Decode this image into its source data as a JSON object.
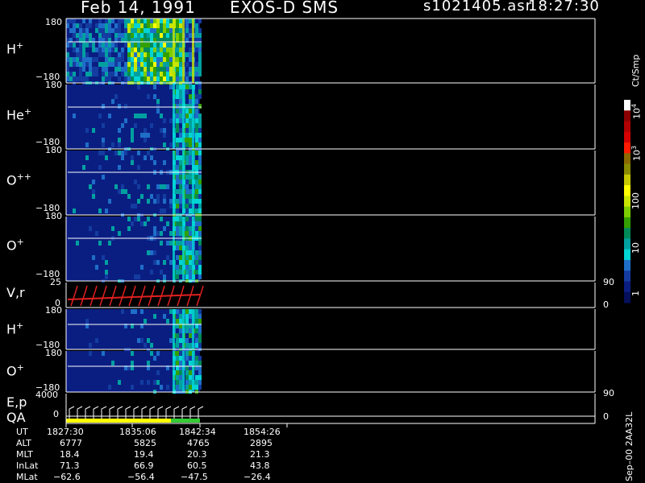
{
  "header": {
    "date": "Feb 14, 1991",
    "mission": "EXOS-D SMS",
    "file": "s1021405.asr",
    "time": "18:27:30"
  },
  "panels": [
    {
      "id": "h_plus",
      "label": "H",
      "sup": "+",
      "ymax": "180",
      "ymin": "−180"
    },
    {
      "id": "he_plus",
      "label": "He",
      "sup": "+",
      "ymax": "180",
      "ymin": "−180"
    },
    {
      "id": "o_pp",
      "label": "O",
      "sup": "++",
      "ymax": "180",
      "ymin": "−180"
    },
    {
      "id": "o_plus",
      "label": "O",
      "sup": "+",
      "ymax": "180",
      "ymin": "−180"
    },
    {
      "id": "vr",
      "label": "V,r",
      "sup": "",
      "ymax": "25",
      "ymin": "0",
      "rmax": "90",
      "rmin": "0"
    },
    {
      "id": "h_plus_2",
      "label": "H",
      "sup": "+",
      "ymax": "180",
      "ymin": "−180"
    },
    {
      "id": "o_plus_2",
      "label": "O",
      "sup": "+",
      "ymax": "180",
      "ymin": "−180"
    },
    {
      "id": "ep",
      "label": "E,p",
      "label2": "QA",
      "sup": "",
      "ymax": "4000",
      "ymin": "0",
      "rmax": "90",
      "rmin": "0"
    }
  ],
  "colorbar": {
    "unit": "Ct/Smp",
    "ticks": [
      {
        "base": "10",
        "exp": "4"
      },
      {
        "base": "10",
        "exp": "3"
      },
      {
        "base": "100",
        "exp": ""
      },
      {
        "base": "10",
        "exp": ""
      },
      {
        "base": "1",
        "exp": ""
      }
    ],
    "colors": [
      "#ffffff",
      "#8b0000",
      "#b00000",
      "#d40000",
      "#ff1a00",
      "#8a6a00",
      "#8a8a00",
      "#c8c800",
      "#ffff00",
      "#c8e600",
      "#7ccd00",
      "#33a000",
      "#008a5a",
      "#00a0a0",
      "#00d4d4",
      "#1e6ec8",
      "#143ca0",
      "#0a1e82",
      "#050f5a"
    ]
  },
  "side_label": "Sep–00  2AA32L",
  "timetable": {
    "rows": [
      {
        "label": "UT",
        "values": [
          "1827:30",
          "1835:06",
          "1842:34",
          "1854:26"
        ]
      },
      {
        "label": "ALT",
        "values": [
          "6777",
          "5825",
          "4765",
          "2895"
        ]
      },
      {
        "label": "MLT",
        "values": [
          "18.4",
          "19.4",
          "20.3",
          "21.3"
        ]
      },
      {
        "label": "InLat",
        "values": [
          "71.3",
          "66.9",
          "60.5",
          "43.8"
        ]
      },
      {
        "label": "MLat",
        "values": [
          "−62.6",
          "−56.4",
          "−47.5",
          "−26.4"
        ]
      }
    ]
  },
  "chart_data": {
    "type": "heatmap",
    "title": "Feb 14, 1991   EXOS-D SMS",
    "x_ticks_ut": [
      "1827:30",
      "1835:06",
      "1842:34",
      "1854:26"
    ],
    "data_coverage_ut": [
      "1827:30",
      "1842:34"
    ],
    "panels": [
      "H+",
      "He+",
      "O++",
      "O+",
      "V,r",
      "H+",
      "O+",
      "E,p QA"
    ],
    "pitch_angle_range": [
      -180,
      180
    ],
    "colorbar_range": [
      1,
      10000
    ],
    "colorbar_scale": "log",
    "colorbar_unit": "Ct/Smp"
  }
}
